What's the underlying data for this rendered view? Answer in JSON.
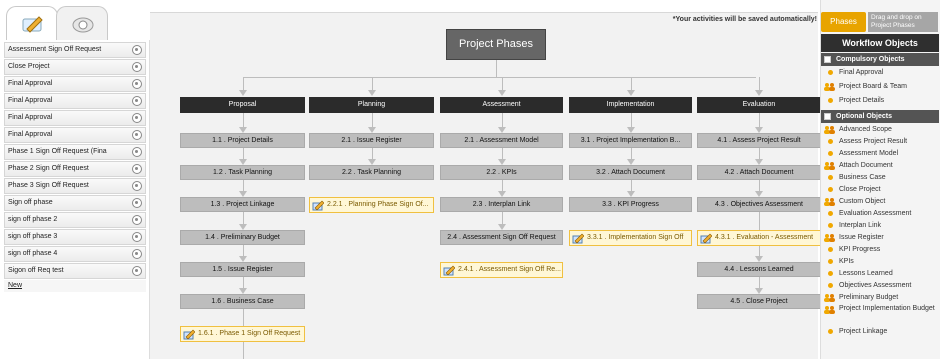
{
  "left_panel": {
    "list": [
      "Assessment Sign Off Request",
      "Close Project",
      "Final Approval",
      "Final Approval",
      "Final Approval",
      "Final Approval",
      "Phase 1 Sign Off Request (Fina",
      "Phase 2 Sign Off Request",
      "Phase 3 Sign Off Request",
      "Sign off phase",
      "sign off phase 2",
      "sign off phase 3",
      "sign off phase 4",
      "Sigon off Req test"
    ],
    "new_label": "New"
  },
  "canvas": {
    "save_note": "*Your activities will be saved automatically!",
    "title": "Project Phases",
    "phases": [
      {
        "name": "Proposal",
        "items": [
          "1.1 . Project Details",
          "1.2 . Task Planning",
          "1.3 . Project Linkage",
          "1.4 . Preliminary Budget",
          "1.5 . Issue Register",
          "1.6 . Business Case"
        ],
        "signoff": "1.6.1 . Phase 1 Sign Off Request"
      },
      {
        "name": "Planning",
        "items": [
          "2.1 . Issue Register",
          "2.2 . Task Planning"
        ],
        "signoff": "2.2.1 . Planning Phase Sign Of..."
      },
      {
        "name": "Assessment",
        "items": [
          "2.1 . Assessment Model",
          "2.2 . KPIs",
          "2.3 . Interplan Link",
          "2.4 . Assessment Sign Off Request"
        ],
        "signoff": "2.4.1 . Assessment Sign Off Re..."
      },
      {
        "name": "Implementation",
        "items": [
          "3.1 . Project Implementation B...",
          "3.2 . Attach Document",
          "3.3 . KPI Progress"
        ],
        "signoff": "3.3.1 . Implementation Sign Off"
      },
      {
        "name": "Evaluation",
        "items": [
          "4.1 . Assess Project Result",
          "4.2 . Attach Document",
          "4.3 . Objectives Assessment",
          "4.4 . Lessons Learned",
          "4.5 . Close Project"
        ],
        "signoff": "4.3.1 . Evaluation - Assessment"
      }
    ]
  },
  "right_panel": {
    "phases_button": "Phases",
    "drag_hint": "Drag and drop on Project Phases",
    "title": "Workflow Objects",
    "compulsory_header": "Compulsory Objects",
    "compulsory": [
      {
        "label": "Final Approval",
        "icon": "dot"
      },
      {
        "label": "Project Board & Team",
        "icon": "people"
      },
      {
        "label": "Project Details",
        "icon": "dot"
      }
    ],
    "optional_header": "Optional Objects",
    "optional": [
      {
        "label": "Advanced Scope",
        "icon": "people"
      },
      {
        "label": "Assess Project Result",
        "icon": "dot"
      },
      {
        "label": "Assessment Model",
        "icon": "dot"
      },
      {
        "label": "Attach Document",
        "icon": "people"
      },
      {
        "label": "Business Case",
        "icon": "dot"
      },
      {
        "label": "Close Project",
        "icon": "dot"
      },
      {
        "label": "Custom Object",
        "icon": "people"
      },
      {
        "label": "Evaluation Assessment",
        "icon": "dot"
      },
      {
        "label": "Interplan Link",
        "icon": "dot"
      },
      {
        "label": "Issue Register",
        "icon": "people"
      },
      {
        "label": "KPI Progress",
        "icon": "dot"
      },
      {
        "label": "KPIs",
        "icon": "dot"
      },
      {
        "label": "Lessons Learned",
        "icon": "dot"
      },
      {
        "label": "Objectives Assessment",
        "icon": "dot"
      },
      {
        "label": "Preliminary Budget",
        "icon": "people"
      },
      {
        "label": "Project Implementation Budget",
        "icon": "people"
      },
      {
        "label": "Project Linkage",
        "icon": "dot"
      }
    ]
  }
}
